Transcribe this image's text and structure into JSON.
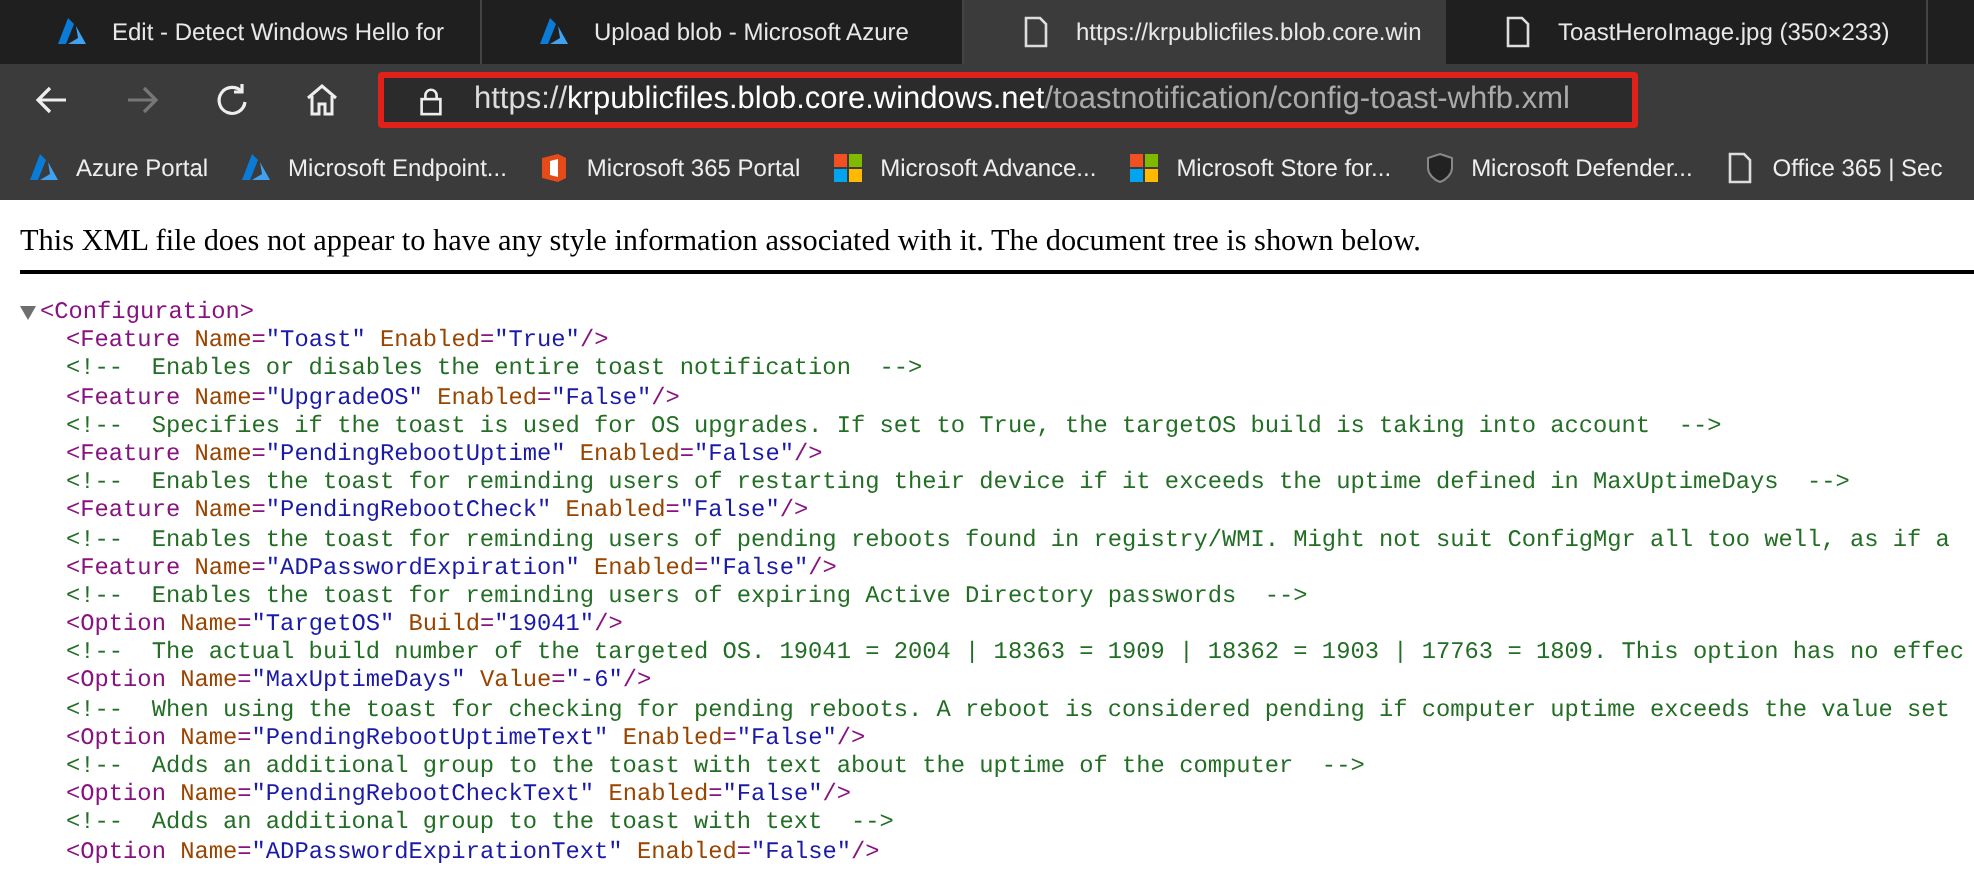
{
  "tabs": [
    {
      "title": "Edit - Detect Windows Hello for",
      "kind": "azure",
      "selected": false
    },
    {
      "title": "Upload blob - Microsoft Azure",
      "kind": "azure",
      "selected": false
    },
    {
      "title": "https://krpublicfiles.blob.core.win",
      "kind": "page",
      "selected": true
    },
    {
      "title": "ToastHeroImage.jpg (350×233)",
      "kind": "page",
      "selected": false
    }
  ],
  "address": {
    "scheme": "https://",
    "host": "krpublicfiles.blob.core.windows.net",
    "path": "/toastnotification/config-toast-whfb.xml",
    "highlighted": true
  },
  "bookmarks": [
    {
      "label": "Azure Portal",
      "kind": "azure"
    },
    {
      "label": "Microsoft Endpoint...",
      "kind": "azure"
    },
    {
      "label": "Microsoft 365 Portal",
      "kind": "office"
    },
    {
      "label": "Microsoft Advance...",
      "kind": "windows"
    },
    {
      "label": "Microsoft Store for...",
      "kind": "windows"
    },
    {
      "label": "Microsoft Defender...",
      "kind": "shield"
    },
    {
      "label": "Office 365 | Sec",
      "kind": "page"
    }
  ],
  "notice": "This XML file does not appear to have any style information associated with it. The document tree is shown below.",
  "xml": {
    "root": "<Configuration>",
    "expanded": true,
    "lines": [
      {
        "kind": "element",
        "text": "<Feature Name=\"Toast\" Enabled=\"True\"/>"
      },
      {
        "kind": "comment",
        "text": "<!--  Enables or disables the entire toast notification  -->"
      },
      {
        "kind": "element",
        "text": "<Feature Name=\"UpgradeOS\" Enabled=\"False\"/>"
      },
      {
        "kind": "comment",
        "text": "<!--  Specifies if the toast is used for OS upgrades. If set to True, the targetOS build is taking into account  -->"
      },
      {
        "kind": "element",
        "text": "<Feature Name=\"PendingRebootUptime\" Enabled=\"False\"/>"
      },
      {
        "kind": "comment",
        "text": "<!--  Enables the toast for reminding users of restarting their device if it exceeds the uptime defined in MaxUptimeDays  -->"
      },
      {
        "kind": "element",
        "text": "<Feature Name=\"PendingRebootCheck\" Enabled=\"False\"/>"
      },
      {
        "kind": "comment",
        "text": "<!--  Enables the toast for reminding users of pending reboots found in registry/WMI. Might not suit ConfigMgr all too well, as if a"
      },
      {
        "kind": "element",
        "text": "<Feature Name=\"ADPasswordExpiration\" Enabled=\"False\"/>"
      },
      {
        "kind": "comment",
        "text": "<!--  Enables the toast for reminding users of expiring Active Directory passwords  -->"
      },
      {
        "kind": "element",
        "text": "<Option Name=\"TargetOS\" Build=\"19041\"/>"
      },
      {
        "kind": "comment",
        "text": "<!--  The actual build number of the targeted OS. 19041 = 2004 | 18363 = 1909 | 18362 = 1903 | 17763 = 1809. This option has no effec"
      },
      {
        "kind": "element",
        "text": "<Option Name=\"MaxUptimeDays\" Value=\"-6\"/>"
      },
      {
        "kind": "comment",
        "text": "<!--  When using the toast for checking for pending reboots. A reboot is considered pending if computer uptime exceeds the value set"
      },
      {
        "kind": "element",
        "text": "<Option Name=\"PendingRebootUptimeText\" Enabled=\"False\"/>"
      },
      {
        "kind": "comment",
        "text": "<!--  Adds an additional group to the toast with text about the uptime of the computer  -->"
      },
      {
        "kind": "element",
        "text": "<Option Name=\"PendingRebootCheckText\" Enabled=\"False\"/>"
      },
      {
        "kind": "comment",
        "text": "<!--  Adds an additional group to the toast with text  -->"
      },
      {
        "kind": "element",
        "text": "<Option Name=\"ADPasswordExpirationText\" Enabled=\"False\"/>"
      }
    ]
  }
}
